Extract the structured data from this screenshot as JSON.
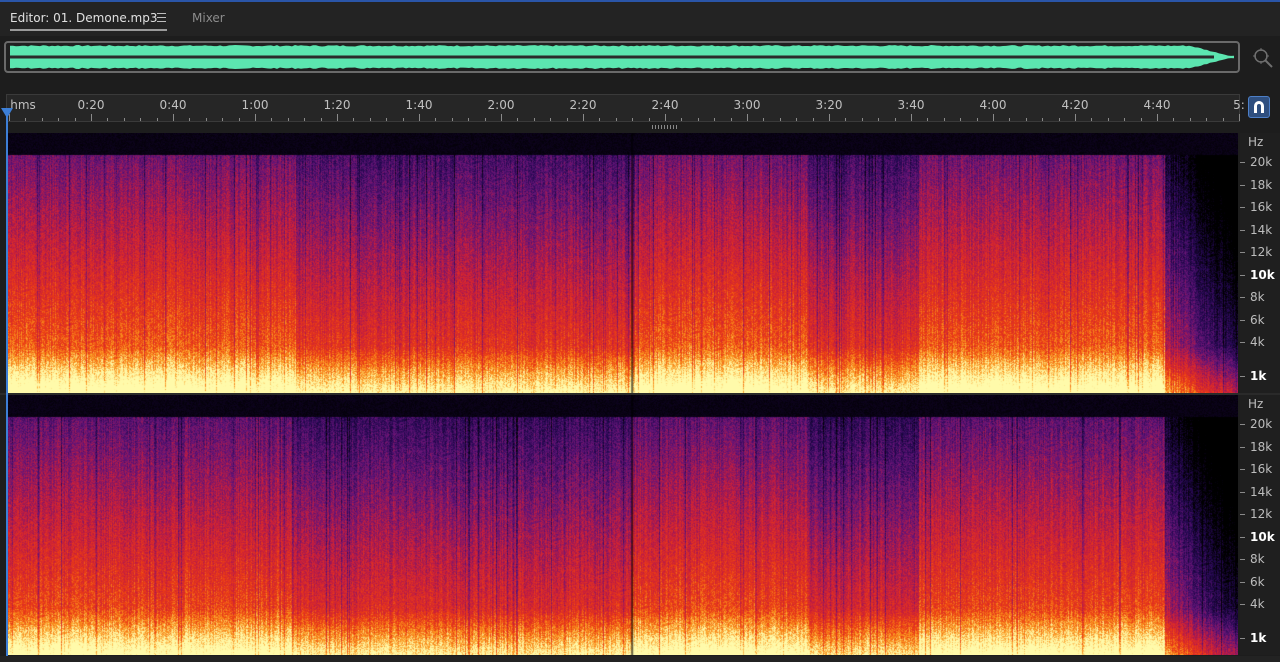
{
  "tabs": {
    "editor_label": "Editor: 01. Demone.mp3",
    "mixer_label": "Mixer"
  },
  "ruler": {
    "unit_label": "hms",
    "duration_seconds": 300,
    "marks": [
      {
        "label": "0:20",
        "seconds": 20
      },
      {
        "label": "0:40",
        "seconds": 40
      },
      {
        "label": "1:00",
        "seconds": 60
      },
      {
        "label": "1:20",
        "seconds": 80
      },
      {
        "label": "1:40",
        "seconds": 100
      },
      {
        "label": "2:00",
        "seconds": 120
      },
      {
        "label": "2:20",
        "seconds": 140
      },
      {
        "label": "2:40",
        "seconds": 160
      },
      {
        "label": "3:00",
        "seconds": 180
      },
      {
        "label": "3:20",
        "seconds": 200
      },
      {
        "label": "3:40",
        "seconds": 220
      },
      {
        "label": "4:00",
        "seconds": 240
      },
      {
        "label": "4:20",
        "seconds": 260
      },
      {
        "label": "4:40",
        "seconds": 280
      },
      {
        "label": "5:",
        "seconds": 300
      }
    ]
  },
  "frequency_scale": {
    "unit": "Hz",
    "max_hz": 22050,
    "labels": [
      {
        "label": "20k",
        "hz": 20000,
        "bold": false
      },
      {
        "label": "18k",
        "hz": 18000,
        "bold": false
      },
      {
        "label": "16k",
        "hz": 16000,
        "bold": false
      },
      {
        "label": "14k",
        "hz": 14000,
        "bold": false
      },
      {
        "label": "12k",
        "hz": 12000,
        "bold": false
      },
      {
        "label": "10k",
        "hz": 10000,
        "bold": true
      },
      {
        "label": "8k",
        "hz": 8000,
        "bold": false
      },
      {
        "label": "6k",
        "hz": 6000,
        "bold": false
      },
      {
        "label": "4k",
        "hz": 4000,
        "bold": false
      },
      {
        "label": "1k",
        "hz": 1000,
        "bold": true
      }
    ]
  },
  "colors": {
    "waveform": "#5ce6b0",
    "playhead": "#3d7fd6",
    "accent": "#2a55a8"
  },
  "icons": {
    "tab_menu": "hamburger-menu-icon",
    "zoom": "zoom-magnifier-icon",
    "snap": "magnet-snap-icon"
  }
}
